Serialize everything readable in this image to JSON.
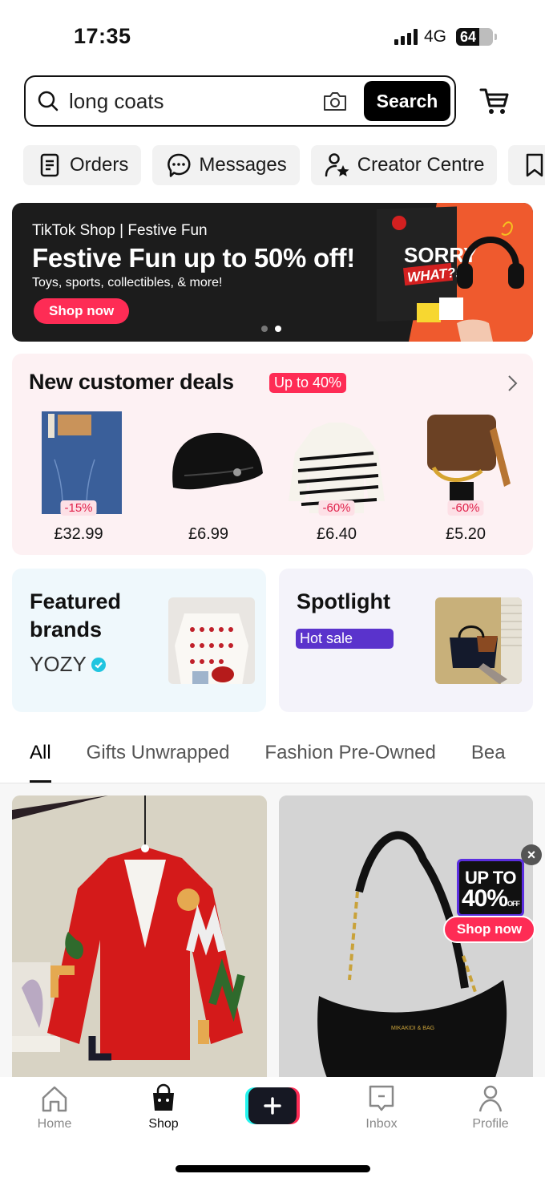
{
  "status_bar": {
    "time": "17:35",
    "network": "4G",
    "battery_percent": 64,
    "battery_label": "64",
    "signal_bars": 4
  },
  "search": {
    "value": "long coats",
    "placeholder": "Search",
    "button_label": "Search",
    "icons": {
      "search": "search-icon",
      "camera": "camera-icon",
      "cart": "cart-icon"
    }
  },
  "quick_links": [
    {
      "label": "Orders",
      "icon": "orders-icon"
    },
    {
      "label": "Messages",
      "icon": "messages-icon"
    },
    {
      "label": "Creator Centre",
      "icon": "creator-icon"
    },
    {
      "label": "",
      "icon": "bookmark-icon"
    }
  ],
  "banner": {
    "kicker": "TikTok Shop | Festive Fun",
    "title": "Festive Fun up to 50% off!",
    "subtitle": "Toys, sports, collectibles, & more!",
    "button_label": "Shop now",
    "art_text": [
      "SORRY",
      "WHAT?!"
    ],
    "slide_count": 2,
    "active_slide": 2,
    "accent_color": "#fe2c55"
  },
  "deals": {
    "title": "New customer deals",
    "badge": "Up to 40%",
    "items": [
      {
        "name": "Jeans",
        "discount": "-15%",
        "price": "£32.99"
      },
      {
        "name": "Cap",
        "discount": "",
        "price": "£6.99"
      },
      {
        "name": "Striped sweater",
        "discount": "-60%",
        "price": "£6.40"
      },
      {
        "name": "Bag",
        "discount": "-60%",
        "price": "£5.20"
      }
    ]
  },
  "featured": {
    "title": "Featured brands",
    "title_line1": "Featured",
    "title_line2": "brands",
    "brand": "YOZY",
    "verified": true
  },
  "spotlight": {
    "title": "Spotlight",
    "badge": "Hot sale"
  },
  "tabs": [
    {
      "label": "All",
      "active": true
    },
    {
      "label": "Gifts Unwrapped",
      "active": false
    },
    {
      "label": "Fashion Pre-Owned",
      "active": false
    },
    {
      "label": "Bea",
      "active": false
    }
  ],
  "promo_popup": {
    "line1": "UP TO",
    "line2": "40%",
    "line2_suffix": "OFF",
    "button_label": "Shop now",
    "close": "×"
  },
  "bottom_nav": [
    {
      "label": "Home",
      "icon": "home-icon",
      "active": false
    },
    {
      "label": "Shop",
      "icon": "shop-bag-icon",
      "active": true
    },
    {
      "label": "",
      "icon": "create-plus-icon",
      "active": false
    },
    {
      "label": "Inbox",
      "icon": "inbox-icon",
      "active": false
    },
    {
      "label": "Profile",
      "icon": "profile-icon",
      "active": false
    }
  ]
}
